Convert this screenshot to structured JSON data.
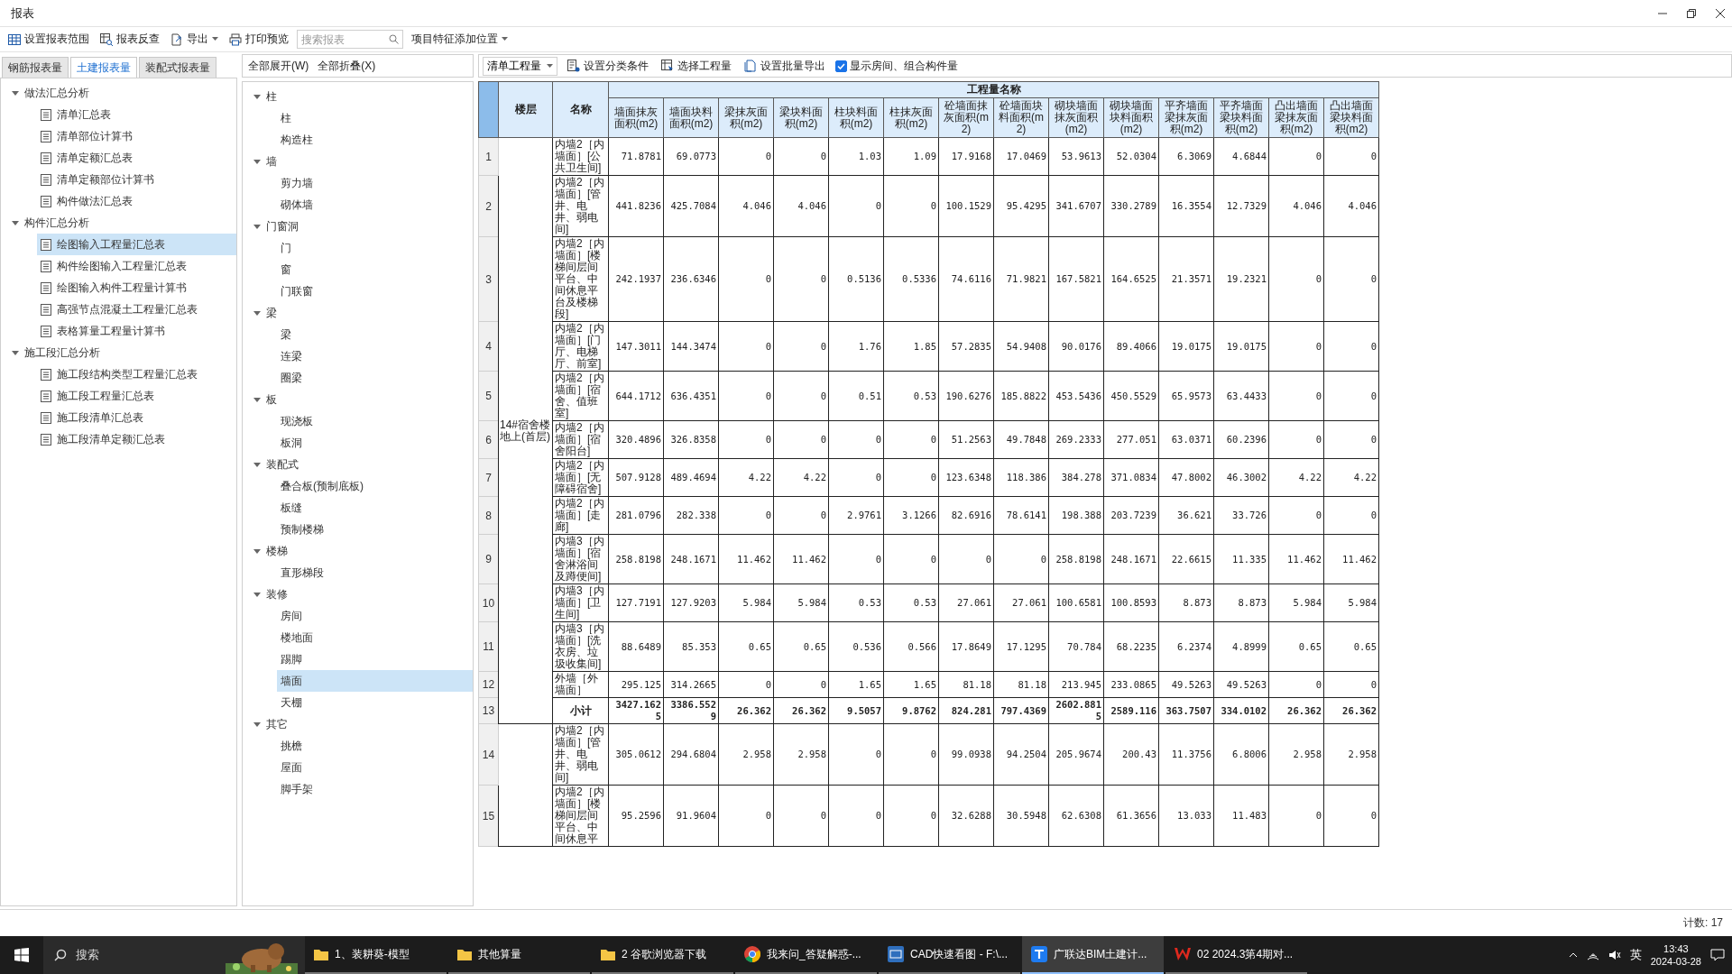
{
  "window": {
    "title": "报表"
  },
  "toolbar": [
    {
      "kind": "button",
      "label": "设置报表范围"
    },
    {
      "kind": "button",
      "label": "报表反查"
    },
    {
      "kind": "menu",
      "label": "导出"
    },
    {
      "kind": "button",
      "label": "打印预览"
    },
    {
      "kind": "search",
      "placeholder": "搜索报表"
    },
    {
      "kind": "dropdown",
      "label": "项目特征添加位置"
    }
  ],
  "report_tabs": [
    {
      "label": "钢筋报表量",
      "selected": false
    },
    {
      "label": "土建报表量",
      "selected": true
    },
    {
      "label": "装配式报表量",
      "selected": false
    }
  ],
  "report_tree": [
    {
      "label": "做法汇总分析",
      "expanded": true,
      "children": [
        {
          "label": "清单汇总表",
          "selected": false
        },
        {
          "label": "清单部位计算书",
          "selected": false
        },
        {
          "label": "清单定额汇总表",
          "selected": false
        },
        {
          "label": "清单定额部位计算书",
          "selected": false
        },
        {
          "label": "构件做法汇总表",
          "selected": false
        }
      ]
    },
    {
      "label": "构件汇总分析",
      "expanded": true,
      "children": [
        {
          "label": "绘图输入工程量汇总表",
          "selected": true
        },
        {
          "label": "构件绘图输入工程量汇总表",
          "selected": false
        },
        {
          "label": "绘图输入构件工程量计算书",
          "selected": false
        },
        {
          "label": "高强节点混凝土工程量汇总表",
          "selected": false
        },
        {
          "label": "表格算量工程量计算书",
          "selected": false
        }
      ]
    },
    {
      "label": "施工段汇总分析",
      "expanded": true,
      "children": [
        {
          "label": "施工段结构类型工程量汇总表",
          "selected": false
        },
        {
          "label": "施工段工程量汇总表",
          "selected": false
        },
        {
          "label": "施工段清单汇总表",
          "selected": false
        },
        {
          "label": "施工段清单定额汇总表",
          "selected": false
        }
      ]
    }
  ],
  "tree_buttons": [
    "全部展开(W)",
    "全部折叠(X)"
  ],
  "component_tree": [
    {
      "label": "柱",
      "expanded": true,
      "children": [
        {
          "label": "柱",
          "selected": false
        },
        {
          "label": "构造柱",
          "selected": false
        }
      ]
    },
    {
      "label": "墙",
      "expanded": true,
      "children": [
        {
          "label": "剪力墙",
          "selected": false
        },
        {
          "label": "砌体墙",
          "selected": false
        }
      ]
    },
    {
      "label": "门窗洞",
      "expanded": true,
      "children": [
        {
          "label": "门",
          "selected": false
        },
        {
          "label": "窗",
          "selected": false
        },
        {
          "label": "门联窗",
          "selected": false
        }
      ]
    },
    {
      "label": "梁",
      "expanded": true,
      "children": [
        {
          "label": "梁",
          "selected": false
        },
        {
          "label": "连梁",
          "selected": false
        },
        {
          "label": "圈梁",
          "selected": false
        }
      ]
    },
    {
      "label": "板",
      "expanded": true,
      "children": [
        {
          "label": "现浇板",
          "selected": false
        },
        {
          "label": "板洞",
          "selected": false
        }
      ]
    },
    {
      "label": "装配式",
      "expanded": true,
      "children": [
        {
          "label": "叠合板(预制底板)",
          "selected": false
        },
        {
          "label": "板缝",
          "selected": false
        },
        {
          "label": "预制楼梯",
          "selected": false
        }
      ]
    },
    {
      "label": "楼梯",
      "expanded": true,
      "children": [
        {
          "label": "直形梯段",
          "selected": false
        }
      ]
    },
    {
      "label": "装修",
      "expanded": true,
      "children": [
        {
          "label": "房间",
          "selected": false
        },
        {
          "label": "楼地面",
          "selected": false
        },
        {
          "label": "踢脚",
          "selected": false
        },
        {
          "label": "墙面",
          "selected": true
        },
        {
          "label": "天棚",
          "selected": false
        }
      ]
    },
    {
      "label": "其它",
      "expanded": true,
      "children": [
        {
          "label": "挑檐",
          "selected": false
        },
        {
          "label": "屋面",
          "selected": false
        },
        {
          "label": "脚手架",
          "selected": false
        }
      ]
    }
  ],
  "table_toolbar": [
    {
      "kind": "dropdown",
      "label": "清单工程量"
    },
    {
      "kind": "button",
      "label": "设置分类条件"
    },
    {
      "kind": "button",
      "label": "选择工程量"
    },
    {
      "kind": "button",
      "label": "设置批量导出"
    },
    {
      "kind": "checkbox",
      "label": "显示房间、组合构件量",
      "checked": true
    }
  ],
  "table": {
    "floor_header": "楼层",
    "name_header": "名称",
    "group_header": "工程量名称",
    "columns": [
      "墙面抹灰面积(m2)",
      "墙面块料面积(m2)",
      "梁抹灰面积(m2)",
      "梁块料面积(m2)",
      "柱块料面积(m2)",
      "柱抹灰面积(m2)",
      "砼墙面抹灰面积(m2)",
      "砼墙面块料面积(m2)",
      "砌块墙面抹灰面积(m2)",
      "砌块墙面块料面积(m2)",
      "平齐墙面梁抹灰面积(m2)",
      "平齐墙面梁块料面积(m2)",
      "凸出墙面梁抹灰面积(m2)",
      "凸出墙面梁块料面积(m2)"
    ],
    "groups": [
      {
        "floor": "14#宿舍楼地上(首层)",
        "rows": [
          {
            "kind": "item",
            "number": "1",
            "name": "内墙2［内墙面］[公共卫生间]",
            "values": [
              "71.8781",
              "69.0773",
              "0",
              "0",
              "1.03",
              "1.09",
              "17.9168",
              "17.0469",
              "53.9613",
              "52.0304",
              "6.3069",
              "4.6844",
              "0",
              "0"
            ]
          },
          {
            "kind": "item",
            "number": "2",
            "name": "内墙2［内墙面］[管井、电井、弱电间]",
            "values": [
              "441.8236",
              "425.7084",
              "4.046",
              "4.046",
              "0",
              "0",
              "100.1529",
              "95.4295",
              "341.6707",
              "330.2789",
              "16.3554",
              "12.7329",
              "4.046",
              "4.046"
            ]
          },
          {
            "kind": "item",
            "number": "3",
            "name": "内墙2［内墙面］[楼梯间层间平台、中间休息平台及楼梯段]",
            "values": [
              "242.1937",
              "236.6346",
              "0",
              "0",
              "0.5136",
              "0.5336",
              "74.6116",
              "71.9821",
              "167.5821",
              "164.6525",
              "21.3571",
              "19.2321",
              "0",
              "0"
            ]
          },
          {
            "kind": "item",
            "number": "4",
            "name": "内墙2［内墙面］[门厅、电梯厅、前室]",
            "values": [
              "147.3011",
              "144.3474",
              "0",
              "0",
              "1.76",
              "1.85",
              "57.2835",
              "54.9408",
              "90.0176",
              "89.4066",
              "19.0175",
              "19.0175",
              "0",
              "0"
            ]
          },
          {
            "kind": "item",
            "number": "5",
            "name": "内墙2［内墙面］[宿舍、值班室]",
            "values": [
              "644.1712",
              "636.4351",
              "0",
              "0",
              "0.51",
              "0.53",
              "190.6276",
              "185.8822",
              "453.5436",
              "450.5529",
              "65.9573",
              "63.4433",
              "0",
              "0"
            ]
          },
          {
            "kind": "item",
            "number": "6",
            "name": "内墙2［内墙面］[宿舍阳台]",
            "values": [
              "320.4896",
              "326.8358",
              "0",
              "0",
              "0",
              "0",
              "51.2563",
              "49.7848",
              "269.2333",
              "277.051",
              "63.0371",
              "60.2396",
              "0",
              "0"
            ]
          },
          {
            "kind": "item",
            "number": "7",
            "name": "内墙2［内墙面］[无障碍宿舍]",
            "values": [
              "507.9128",
              "489.4694",
              "4.22",
              "4.22",
              "0",
              "0",
              "123.6348",
              "118.386",
              "384.278",
              "371.0834",
              "47.8002",
              "46.3002",
              "4.22",
              "4.22"
            ]
          },
          {
            "kind": "item",
            "number": "8",
            "name": "内墙2［内墙面］[走廊]",
            "values": [
              "281.0796",
              "282.338",
              "0",
              "0",
              "2.9761",
              "3.1266",
              "82.6916",
              "78.6141",
              "198.388",
              "203.7239",
              "36.621",
              "33.726",
              "0",
              "0"
            ]
          },
          {
            "kind": "item",
            "number": "9",
            "name": "内墙3［内墙面］[宿舍淋浴间及蹲便间]",
            "values": [
              "258.8198",
              "248.1671",
              "11.462",
              "11.462",
              "0",
              "0",
              "0",
              "0",
              "258.8198",
              "248.1671",
              "22.6615",
              "11.335",
              "11.462",
              "11.462"
            ]
          },
          {
            "kind": "item",
            "number": "10",
            "name": "内墙3［内墙面］[卫生间]",
            "values": [
              "127.7191",
              "127.9203",
              "5.984",
              "5.984",
              "0.53",
              "0.53",
              "27.061",
              "27.061",
              "100.6581",
              "100.8593",
              "8.873",
              "8.873",
              "5.984",
              "5.984"
            ]
          },
          {
            "kind": "item",
            "number": "11",
            "name": "内墙3［内墙面］[洗衣房、垃圾收集间]",
            "values": [
              "88.6489",
              "85.353",
              "0.65",
              "0.65",
              "0.536",
              "0.566",
              "17.8649",
              "17.1295",
              "70.784",
              "68.2235",
              "6.2374",
              "4.8999",
              "0.65",
              "0.65"
            ]
          },
          {
            "kind": "item",
            "number": "12",
            "name": "外墙［外墙面］",
            "values": [
              "295.125",
              "314.2665",
              "0",
              "0",
              "1.65",
              "1.65",
              "81.18",
              "81.18",
              "213.945",
              "233.0865",
              "49.5263",
              "49.5263",
              "0",
              "0"
            ]
          },
          {
            "kind": "subtotal",
            "number": "13",
            "name": "小计",
            "values": [
              "3427.1625",
              "3386.5529",
              "26.362",
              "26.362",
              "9.5057",
              "9.8762",
              "824.281",
              "797.4369",
              "2602.8815",
              "2589.116",
              "363.7507",
              "334.0102",
              "26.362",
              "26.362"
            ]
          }
        ]
      },
      {
        "rows": [
          {
            "kind": "item",
            "number": "14",
            "name": "内墙2［内墙面］[管井、电井、弱电间]",
            "values": [
              "305.0612",
              "294.6804",
              "2.958",
              "2.958",
              "0",
              "0",
              "99.0938",
              "94.2504",
              "205.9674",
              "200.43",
              "11.3756",
              "6.8006",
              "2.958",
              "2.958"
            ]
          },
          {
            "kind": "item",
            "number": "15",
            "name": "内墙2［内墙面］[楼梯间层间平台、中间休息平",
            "values": [
              "95.2596",
              "91.9604",
              "0",
              "0",
              "0",
              "0",
              "32.6288",
              "30.5948",
              "62.6308",
              "61.3656",
              "13.033",
              "11.483",
              "0",
              "0"
            ]
          }
        ]
      }
    ]
  },
  "status_bar": {
    "count": "计数: 17"
  },
  "taskbar": {
    "search": "搜索",
    "apps": [
      {
        "label": "1、装耕葵-模型",
        "selected": false
      },
      {
        "label": "其他算量",
        "selected": false
      },
      {
        "label": "2 谷歌浏览器下载",
        "selected": false
      },
      {
        "label": "我来问_答疑解惑-...",
        "selected": false
      },
      {
        "label": "CAD快速看图 - F:\\...",
        "selected": false
      },
      {
        "label": "广联达BIM土建计...",
        "selected": true
      },
      {
        "label": "02 2024.3第4期对...",
        "selected": false
      }
    ],
    "tray": {
      "ime": "英",
      "time": "13:43",
      "date": "2024-03-28"
    }
  }
}
